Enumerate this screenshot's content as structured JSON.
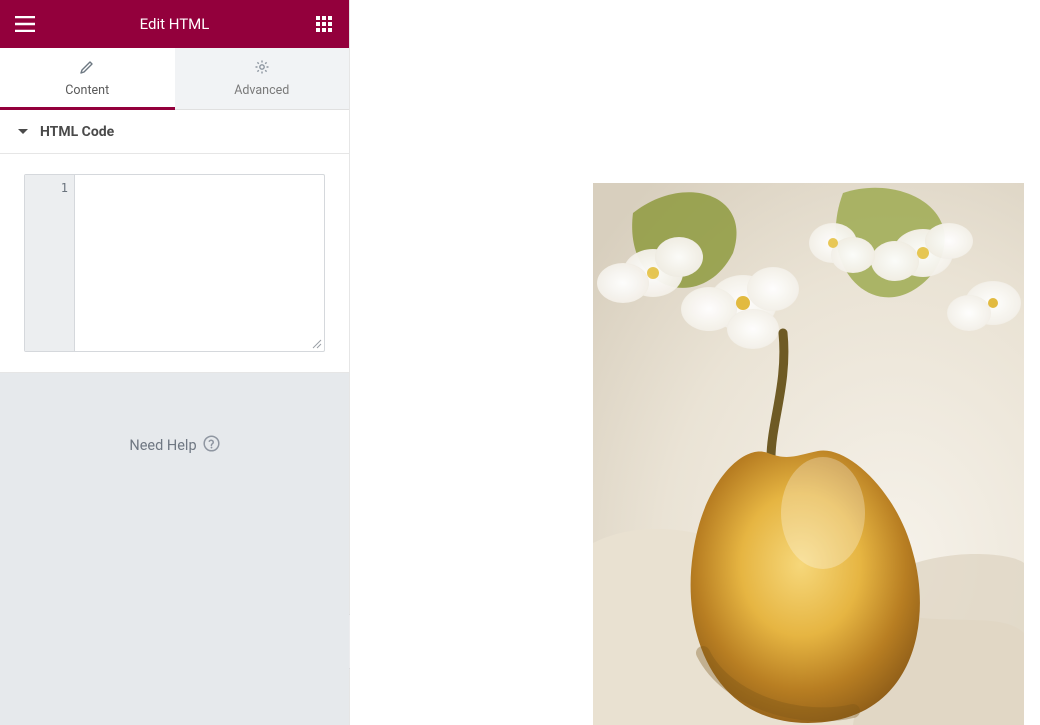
{
  "header": {
    "title": "Edit HTML"
  },
  "tabs": {
    "content": "Content",
    "advanced": "Advanced"
  },
  "section": {
    "title": "HTML Code"
  },
  "editor": {
    "line_number": "1",
    "value": ""
  },
  "help": {
    "text": "Need Help"
  },
  "colors": {
    "brand": "#93003c"
  }
}
